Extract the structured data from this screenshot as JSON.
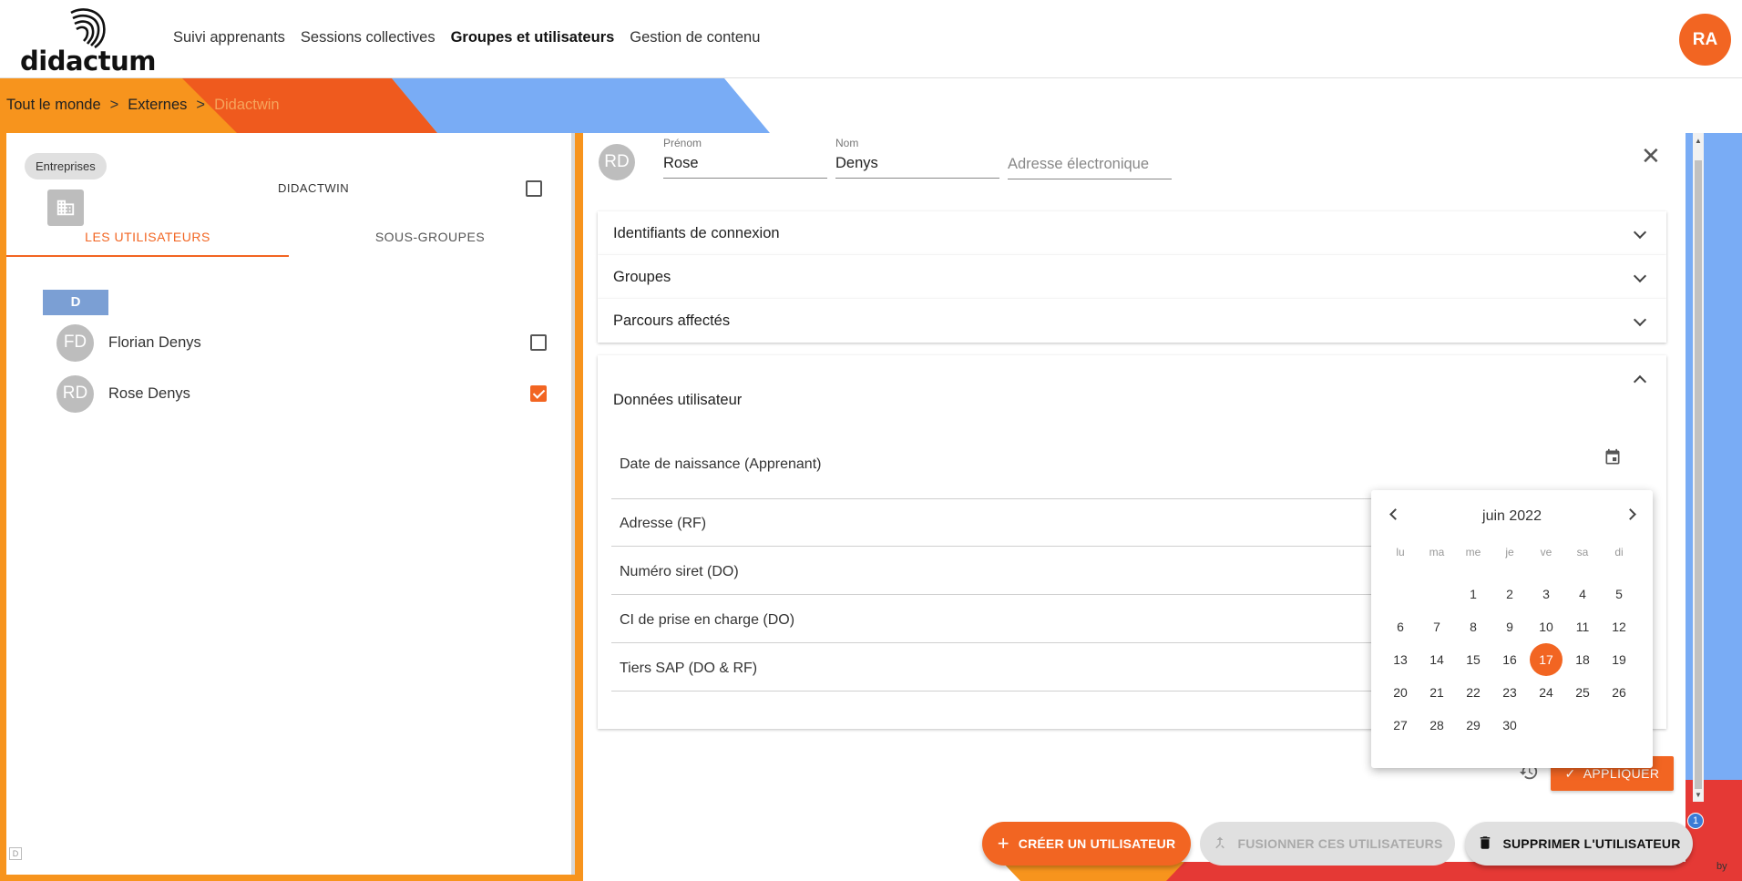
{
  "brand": {
    "name": "didactum",
    "accent": "#f26522"
  },
  "nav": {
    "items": [
      "Suivi apprenants",
      "Sessions collectives",
      "Groupes et utilisateurs",
      "Gestion de contenu"
    ],
    "active": "Groupes et utilisateurs"
  },
  "user": {
    "initials": "RA"
  },
  "breadcrumb": {
    "root": "Tout le monde",
    "sep": ">",
    "level1": "Externes",
    "current": "Didactwin"
  },
  "left": {
    "chip": "Entreprises",
    "org_name": "DIDACTWIN",
    "org_icon": "building-icon",
    "tabs": [
      "LES UTILISATEURS",
      "SOUS-GROUPES"
    ],
    "letter": "D",
    "users": [
      {
        "initials": "FD",
        "name": "Florian Denys",
        "checked": false
      },
      {
        "initials": "RD",
        "name": "Rose Denys",
        "checked": true
      }
    ],
    "corner_glyph": "D"
  },
  "detail": {
    "initials": "RD",
    "firstname_label": "Prénom",
    "firstname": "Rose",
    "lastname_label": "Nom",
    "lastname": "Denys",
    "email_placeholder": "Adresse électronique",
    "sections": [
      "Identifiants de connexion",
      "Groupes",
      "Parcours affectés"
    ],
    "data_section": "Données utilisateur",
    "data_fields": [
      "Date de naissance (Apprenant)",
      "Adresse (RF)",
      "Numéro siret (DO)",
      "CI de prise en charge (DO)",
      "Tiers SAP (DO & RF)"
    ],
    "apply_label": "APPLIQUER"
  },
  "datepicker": {
    "month_label": "juin 2022",
    "weekdays": [
      "lu",
      "ma",
      "me",
      "je",
      "ve",
      "sa",
      "di"
    ],
    "leading_blanks": 2,
    "days": 30,
    "selected": 17
  },
  "actions": {
    "create": "CRÉER UN UTILISATEUR",
    "merge": "FUSIONNER CES UTILISATEURS",
    "delete": "SUPPRIMER L'UTILISATEUR",
    "badge": "1"
  },
  "byline": "by"
}
